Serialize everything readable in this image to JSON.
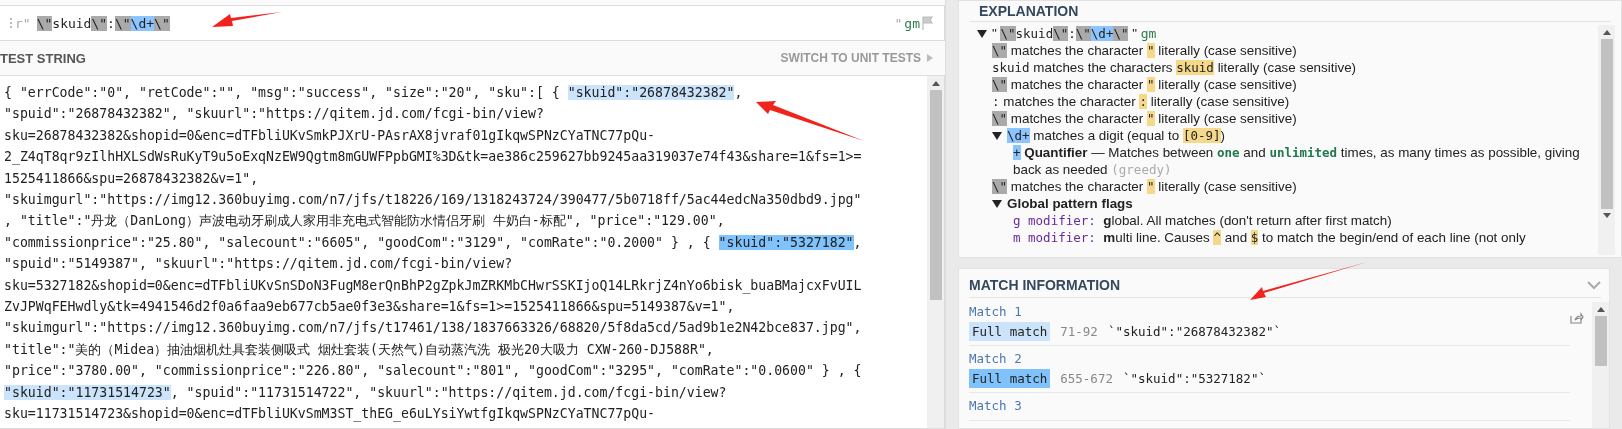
{
  "regex": {
    "prefix": "r\"",
    "segments": [
      {
        "text": "\\\"",
        "kind": "gray"
      },
      {
        "text": "skuid",
        "kind": "plain"
      },
      {
        "text": "\\\"",
        "kind": "gray"
      },
      {
        "text": ":",
        "kind": "plain"
      },
      {
        "text": "\\\"",
        "kind": "gray"
      },
      {
        "text": "\\d+",
        "kind": "blue"
      },
      {
        "text": "\\\"",
        "kind": "gray"
      }
    ],
    "delimiter": "\"",
    "flags": "gm"
  },
  "test_string": {
    "title": "TEST STRING",
    "switch_link": "SWITCH TO UNIT TESTS",
    "lines": [
      [
        {
          "text": "{ \"errCode\":\"0\", \"retCode\":\"\", \"msg\":\"success\", \"size\":\"20\", \"sku\":[ { "
        },
        {
          "text": "\"skuid\":\"26878432382\"",
          "color": "#cce4fb"
        },
        {
          "text": ","
        }
      ],
      [
        {
          "text": "\"spuid\":\"26878432382\", \"skuurl\":\"https://qitem.jd.com/fcgi-bin/view?"
        }
      ],
      [
        {
          "text": "sku=26878432382&shopid=0&enc=dTFbliUKvSmkPJXrU-PAsrAX8jvraf01gIkqwSPNzCYaTNC77pQu-"
        }
      ],
      [
        {
          "text": "2_Z4qT8qr9zIlhHXLSdWsRuKyT9u5oExqNzEW9Qgtm8mGUWFPpbGMI%3D&tk=ae386c259627bb9245aa319037e74f43&share=1&fs=1>="
        }
      ],
      [
        {
          "text": "1525411866&spu=26878432382&v=1\","
        }
      ],
      [
        {
          "text": "\"skuimgurl\":\"https://img12.360buyimg.com/n7/jfs/t18226/169/1318243724/390477/5b0718ff/5ac44edcNa350dbd9.jpg\""
        }
      ],
      [
        {
          "text": ", \"title\":\"丹龙（DanLong）声波电动牙刷成人家用非充电式智能防水情侣牙刷 牛奶白-标配\", \"price\":\"129.00\","
        }
      ],
      [
        {
          "text": "\"commissionprice\":\"25.80\", \"salecount\":\"6605\", \"goodCom\":\"3129\", \"comRate\":\"0.2000\" } , { "
        },
        {
          "text": "\"skuid\":\"5327182\"",
          "color": "#80c2fb"
        },
        {
          "text": ","
        }
      ],
      [
        {
          "text": "\"spuid\":\"5149387\", \"skuurl\":\"https://qitem.jd.com/fcgi-bin/view?"
        }
      ],
      [
        {
          "text": "sku=5327182&shopid=0&enc=dTFbliUKvSnSDoN3FugM8erQnBhP2gZpkJmZRKMbCHwrSSKIjoQ14LRkrjZ4nYo6bisk_buaBMajcxFvUIL"
        }
      ],
      [
        {
          "text": "ZvJPWqFEHwdly&tk=4941546d2f0a6faa9eb677cb5ae0f3e3&share=1&fs=1>=1525411866&spu=5149387&v=1\","
        }
      ],
      [
        {
          "text": "\"skuimgurl\":\"https://img12.360buyimg.com/n7/jfs/t17461/138/1837663326/68820/5f8da5cd/5ad9b1e2N42bce837.jpg\","
        }
      ],
      [
        {
          "text": "\"title\":\"美的（Midea）抽油烟机灶具套装侧吸式 烟灶套装(天然气)自动蒸汽洗 极光20大吸力 CXW-260-DJ588R\","
        }
      ],
      [
        {
          "text": "\"price\":\"3780.00\", \"commissionprice\":\"226.80\", \"salecount\":\"801\", \"goodCom\":\"3295\", \"comRate\":\"0.0600\" } , {"
        }
      ],
      [
        {
          "text": "\"skuid\":\"11731514723\"",
          "color": "#cce4fb"
        },
        {
          "text": ", \"spuid\":\"11731514722\", \"skuurl\":\"https://qitem.jd.com/fcgi-bin/view?"
        }
      ],
      [
        {
          "text": "sku=11731514723&shopid=0&enc=dTFbliUKvSmM3ST_thEG_e6uLYsiYwtfgIkqwSPNzCYaTNC77pQu-"
        }
      ]
    ]
  },
  "explanation": {
    "title": "EXPLANATION",
    "tree": [
      {
        "expanded": true,
        "segments": [
          {
            "text": "\" ",
            "kind": "text"
          },
          {
            "text": "\\\"",
            "kind": "gray"
          },
          {
            "text": "skuid",
            "kind": "code"
          },
          {
            "text": "\\\"",
            "kind": "gray"
          },
          {
            "text": ":",
            "kind": "code"
          },
          {
            "text": "\\\"",
            "kind": "gray"
          },
          {
            "text": "\\d+",
            "kind": "blue"
          },
          {
            "text": "\\\"",
            "kind": "gray"
          },
          {
            "text": " \" ",
            "kind": "text"
          },
          {
            "text": "gm",
            "kind": "flag"
          }
        ],
        "children": [
          {
            "segments": [
              {
                "text": "\\\"",
                "kind": "gray"
              },
              {
                "text": " matches the character ",
                "kind": "text"
              },
              {
                "text": "\"",
                "kind": "lit"
              },
              {
                "text": " literally (case sensitive)",
                "kind": "text"
              }
            ]
          },
          {
            "segments": [
              {
                "text": "skuid",
                "kind": "code"
              },
              {
                "text": " matches the characters ",
                "kind": "text"
              },
              {
                "text": "skuid",
                "kind": "lit"
              },
              {
                "text": " literally (case sensitive)",
                "kind": "text"
              }
            ]
          },
          {
            "segments": [
              {
                "text": "\\\"",
                "kind": "gray"
              },
              {
                "text": " matches the character ",
                "kind": "text"
              },
              {
                "text": "\"",
                "kind": "lit"
              },
              {
                "text": " literally (case sensitive)",
                "kind": "text"
              }
            ]
          },
          {
            "segments": [
              {
                "text": ":",
                "kind": "code"
              },
              {
                "text": " matches the character ",
                "kind": "text"
              },
              {
                "text": ":",
                "kind": "lit"
              },
              {
                "text": " literally (case sensitive)",
                "kind": "text"
              }
            ]
          },
          {
            "segments": [
              {
                "text": "\\\"",
                "kind": "gray"
              },
              {
                "text": " matches the character ",
                "kind": "text"
              },
              {
                "text": "\"",
                "kind": "lit"
              },
              {
                "text": " literally (case sensitive)",
                "kind": "text"
              }
            ]
          },
          {
            "expanded": true,
            "segments": [
              {
                "text": "\\d+",
                "kind": "blue"
              },
              {
                "text": " matches a digit (equal to ",
                "kind": "text"
              },
              {
                "text": "[0-9]",
                "kind": "lit"
              },
              {
                "text": ")",
                "kind": "text"
              }
            ],
            "children": [
              {
                "segments": [
                  {
                    "text": "+",
                    "kind": "blue"
                  },
                  {
                    "text": " Quantifier",
                    "kind": "bold"
                  },
                  {
                    "text": " — Matches between ",
                    "kind": "text"
                  },
                  {
                    "text": "one",
                    "kind": "green"
                  },
                  {
                    "text": " and ",
                    "kind": "text"
                  },
                  {
                    "text": "unlimited",
                    "kind": "green"
                  },
                  {
                    "text": " times, as many times as possible, giving back as needed ",
                    "kind": "text"
                  },
                  {
                    "text": "(greedy)",
                    "kind": "muted"
                  }
                ]
              }
            ]
          },
          {
            "segments": [
              {
                "text": "\\\"",
                "kind": "gray"
              },
              {
                "text": " matches the character ",
                "kind": "text"
              },
              {
                "text": "\"",
                "kind": "lit"
              },
              {
                "text": " literally (case sensitive)",
                "kind": "text"
              }
            ]
          },
          {
            "expanded": true,
            "segments": [
              {
                "text": "Global pattern flags",
                "kind": "bold"
              }
            ],
            "children": [
              {
                "segments": [
                  {
                    "text": "g modifier: ",
                    "kind": "purple"
                  },
                  {
                    "text": "g",
                    "kind": "bold"
                  },
                  {
                    "text": "lobal. All matches (don't return after first match)",
                    "kind": "text"
                  }
                ]
              },
              {
                "segments": [
                  {
                    "text": "m modifier: ",
                    "kind": "purple"
                  },
                  {
                    "text": "m",
                    "kind": "bold"
                  },
                  {
                    "text": "ulti line. Causes ",
                    "kind": "text"
                  },
                  {
                    "text": "^",
                    "kind": "lit"
                  },
                  {
                    "text": " and ",
                    "kind": "text"
                  },
                  {
                    "text": "$",
                    "kind": "lit"
                  },
                  {
                    "text": " to match the begin/end of each line (not only",
                    "kind": "text"
                  }
                ]
              }
            ]
          }
        ]
      }
    ]
  },
  "match_information": {
    "title": "MATCH INFORMATION",
    "matches": [
      {
        "title": "Match 1",
        "groups": [
          {
            "label": "Full match",
            "range": "71-92",
            "value": "`\"skuid\":\"26878432382\"`"
          }
        ]
      },
      {
        "title": "Match 2",
        "groups": [
          {
            "label": "Full match",
            "range": "655-672",
            "value": "`\"skuid\":\"5327182\"`"
          }
        ]
      },
      {
        "title": "Match 3"
      }
    ]
  }
}
